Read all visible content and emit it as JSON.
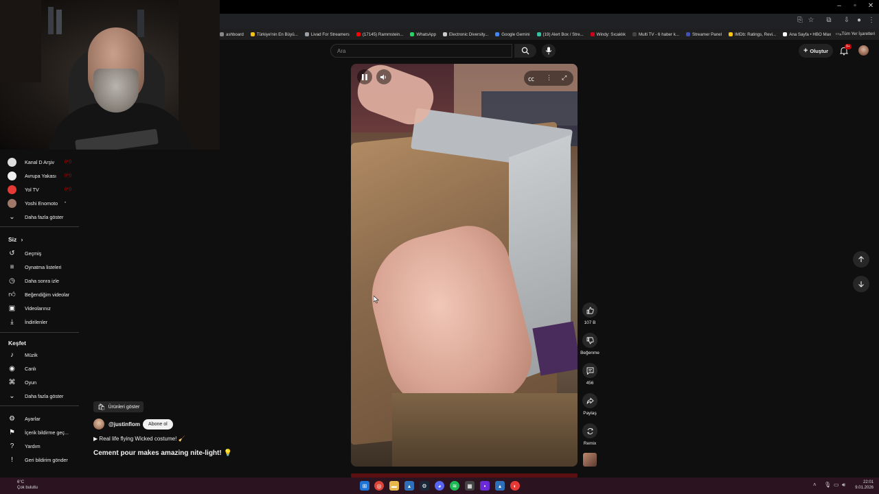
{
  "browser": {
    "window_controls": [
      "–",
      "▫",
      "✕"
    ],
    "bookmarks": [
      {
        "label": "ashboard",
        "color": "#888888"
      },
      {
        "label": "Türkiye'nin En Büyü...",
        "color": "#f4c20d"
      },
      {
        "label": "Livad For Streamers",
        "color": "#9aa0a6"
      },
      {
        "label": "(17145) Rammstein...",
        "color": "#ff0000"
      },
      {
        "label": "WhatsApp",
        "color": "#25d366"
      },
      {
        "label": "Electronic Diversity...",
        "color": "#cccccc"
      },
      {
        "label": "Google Gemini",
        "color": "#4285f4"
      },
      {
        "label": "(19) Alert Box / Stre...",
        "color": "#31c3a2"
      },
      {
        "label": "Windy: Sıcaklık",
        "color": "#d0021b"
      },
      {
        "label": "Multi TV - 6 haber k...",
        "color": "#444444"
      },
      {
        "label": "Streamer Panel",
        "color": "#3f51b5"
      },
      {
        "label": "IMDb: Ratings, Revi...",
        "color": "#f5c518"
      },
      {
        "label": "Ana Sayfa • HBO Max",
        "color": "#ffffff"
      }
    ],
    "bookmarks_overflow": "»",
    "all_bookmarks": "Tüm Yer İşaretleri"
  },
  "sidebar": {
    "subscriptions": [
      {
        "label": "Kanal D Arşiv",
        "color": "#dddddd",
        "live": "((•))"
      },
      {
        "label": "Avrupa Yakası",
        "color": "#eeeeee",
        "live": "((•))"
      },
      {
        "label": "Yol TV",
        "color": "#e53935",
        "live": "((•))"
      },
      {
        "label": "Yoshi Enomoto",
        "color": "#a0786a",
        "live": "•"
      }
    ],
    "show_more_1": "Daha fazla göster",
    "you_heading": "Siz",
    "you_items": [
      {
        "label": "Geçmiş",
        "icon": "history-icon"
      },
      {
        "label": "Oynatma listeleri",
        "icon": "playlists-icon"
      },
      {
        "label": "Daha sonra izle",
        "icon": "watch-later-icon"
      },
      {
        "label": "Beğendiğim videolar",
        "icon": "liked-videos-icon"
      },
      {
        "label": "Videolarınız",
        "icon": "your-videos-icon"
      },
      {
        "label": "İndirilenler",
        "icon": "downloads-icon"
      }
    ],
    "explore_heading": "Keşfet",
    "explore_items": [
      {
        "label": "Müzik",
        "icon": "music-icon"
      },
      {
        "label": "Canlı",
        "icon": "live-icon"
      },
      {
        "label": "Oyun",
        "icon": "gaming-icon"
      }
    ],
    "show_more_2": "Daha fazla göster",
    "settings_items": [
      {
        "label": "Ayarlar",
        "icon": "settings-icon"
      },
      {
        "label": "İçerik bildirme geç...",
        "icon": "flag-icon"
      },
      {
        "label": "Yardım",
        "icon": "help-icon"
      },
      {
        "label": "Geri bildirim gönder",
        "icon": "feedback-icon"
      }
    ]
  },
  "header": {
    "search_placeholder": "Ara",
    "create_label": "Oluştur",
    "notification_badge": "9+"
  },
  "short": {
    "products_label": "Ürünleri göster",
    "channel": "@justinflom",
    "subscribe_label": "Abone ol",
    "subtitle": "▶ Real life flying Wicked costume! 🧹",
    "title": "Cement pour makes amazing nite-light! 💡",
    "likes": "107 B",
    "dislike_label": "Beğenme",
    "comments": "456",
    "share_label": "Paylaş",
    "remix_label": "Remix"
  },
  "taskbar": {
    "weather_temp": "6°C",
    "weather_desc": "Çok bulutlu",
    "time": "22:01",
    "date": "9.01.2026"
  },
  "colors": {
    "accent": "#ff0000",
    "background": "#0f0f0f",
    "taskbar": "#2b1420"
  }
}
